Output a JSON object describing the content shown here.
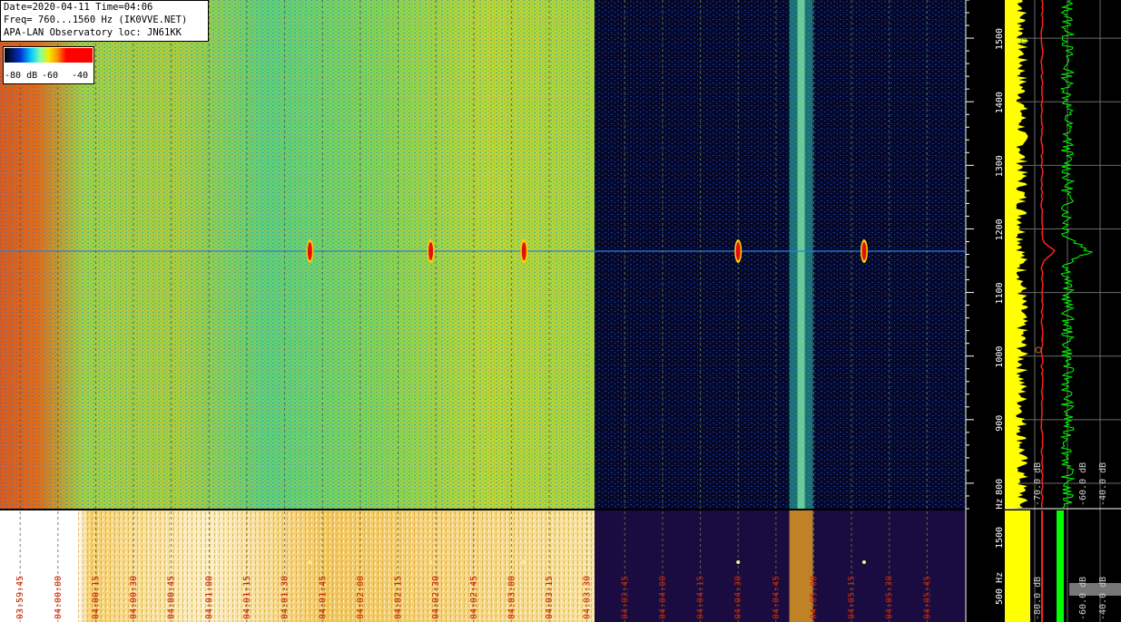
{
  "header": {
    "line1": "Date=2020-04-11 Time=04:06",
    "line2": "Freq= 760...1560 Hz (IK0VVE.NET)",
    "line3": "APA-LAN Observatory loc: JN61KK"
  },
  "colorbar": {
    "label_min": "-80 dB",
    "label_mid": "-60",
    "label_max": "-40"
  },
  "colors": {
    "background": "#000000",
    "grid_line": "#7a8f3a",
    "tick_red": "#cc2200",
    "spectrum_yellow": "#ffff00",
    "spectrum_green": "#00ff00",
    "spectrum_red": "#ff2020"
  },
  "chart_data": [
    {
      "type": "heatmap",
      "title": "",
      "xlabel": "",
      "ylabel": "",
      "x_tick_labels": [
        "03:59:45",
        "04:00:00",
        "04:00:15",
        "04:00:30",
        "04:00:45",
        "04:01:00",
        "04:01:15",
        "04:01:30",
        "04:01:45",
        "04:02:00",
        "04:02:15",
        "04:02:30",
        "04:02:45",
        "04:03:00",
        "04:03:15",
        "04:03:30",
        "04:03:45",
        "04:04:00",
        "04:04:15",
        "04:04:30",
        "04:04:45",
        "04:05:00",
        "04:05:15",
        "04:05:30",
        "04:05:45"
      ],
      "x_range": [
        "03:59:37",
        "04:06:00"
      ],
      "y_range": [
        760,
        1560
      ],
      "y_unit": "Hz",
      "y_ticks": [
        800,
        900,
        1000,
        1100,
        1200,
        1300,
        1400,
        1500
      ],
      "y_tick_labels": [
        "800",
        "900",
        "1000",
        "1100",
        "1200",
        "1300",
        "1400",
        "1500"
      ],
      "y_unit_label": "Hz",
      "color_scale_db": [
        -80,
        -40
      ],
      "carrier_freq_hz": 1165,
      "strong_echo_times": [
        "04:01:40",
        "04:02:28",
        "04:03:05",
        "04:04:30",
        "04:05:20"
      ],
      "background_change_time": "04:03:33"
    },
    {
      "type": "line",
      "title": "",
      "x_axis": "dB",
      "x_tick_labels": [
        "-70.0 dB",
        "-60.0 dB",
        "-40.0 dB"
      ],
      "series": [
        {
          "name": "",
          "color": "#ffff00"
        },
        {
          "name": "",
          "color": "#ff2020"
        },
        {
          "name": "",
          "color": "#00ff00"
        }
      ],
      "peak_freq_hz": 1165
    },
    {
      "type": "heatmap",
      "title": "",
      "y_tick_labels": [
        "1500",
        "500 Hz"
      ],
      "x_tick_labels": [
        "-80.0 dB",
        "-60.0 dB",
        "-40.0 dB"
      ]
    }
  ]
}
